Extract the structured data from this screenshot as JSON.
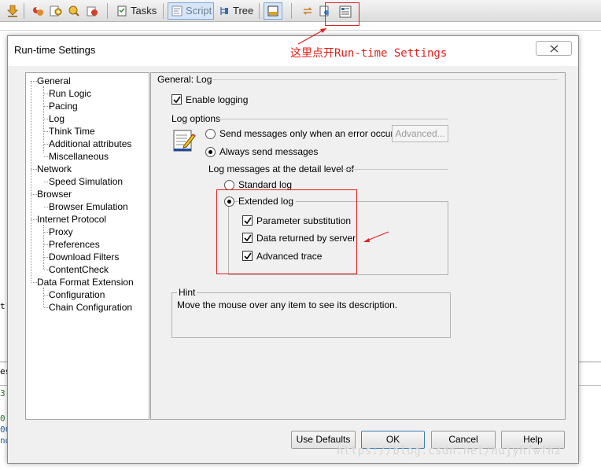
{
  "toolbar": {
    "tasks_label": "Tasks",
    "script_label": "Script",
    "tree_label": "Tree"
  },
  "background": {
    "left_fragments": [
      "t",
      "es",
      "3",
      "0",
      "0C",
      "nd"
    ]
  },
  "dialog": {
    "title": "Run-time Settings",
    "tree": [
      {
        "label": "General"
      },
      {
        "label": "Run Logic"
      },
      {
        "label": "Pacing"
      },
      {
        "label": "Log"
      },
      {
        "label": "Think Time"
      },
      {
        "label": "Additional attributes"
      },
      {
        "label": "Miscellaneous"
      },
      {
        "label": "Network"
      },
      {
        "label": "Speed Simulation"
      },
      {
        "label": "Browser"
      },
      {
        "label": "Browser Emulation"
      },
      {
        "label": "Internet Protocol"
      },
      {
        "label": "Proxy"
      },
      {
        "label": "Preferences"
      },
      {
        "label": "Download Filters"
      },
      {
        "label": "ContentCheck"
      },
      {
        "label": "Data Format Extension"
      },
      {
        "label": "Configuration"
      },
      {
        "label": "Chain Configuration"
      }
    ],
    "panel": {
      "title": "General: Log",
      "enable_logging": {
        "label": "Enable logging",
        "checked": true
      },
      "log_options_title": "Log options",
      "send_on_error": {
        "label": "Send messages only when an error occurs",
        "checked": false
      },
      "advanced_button": "Advanced...",
      "always_send": {
        "label": "Always send messages",
        "checked": true
      },
      "detail_level_title": "Log messages at the detail level of",
      "standard_log": {
        "label": "Standard log",
        "checked": false
      },
      "extended_log": {
        "label": "Extended log",
        "checked": true
      },
      "parameter_substitution": {
        "label": "Parameter substitution",
        "checked": true
      },
      "data_returned": {
        "label": "Data returned by server",
        "checked": true
      },
      "advanced_trace": {
        "label": "Advanced trace",
        "checked": true
      },
      "hint_title": "Hint",
      "hint_text": "Move the mouse over any item to see its description."
    },
    "buttons": {
      "use_defaults": "Use Defaults",
      "ok": "OK",
      "cancel": "Cancel",
      "help": "Help"
    }
  },
  "annotation": {
    "text": "这里点开Run-time Settings",
    "color": "#e0201b"
  },
  "watermark": "https://blog.csdn.net/hujyhfwfh2",
  "colors": {
    "annotation_red": "#e0201b",
    "toolbar_active": "#d7e6f7"
  }
}
